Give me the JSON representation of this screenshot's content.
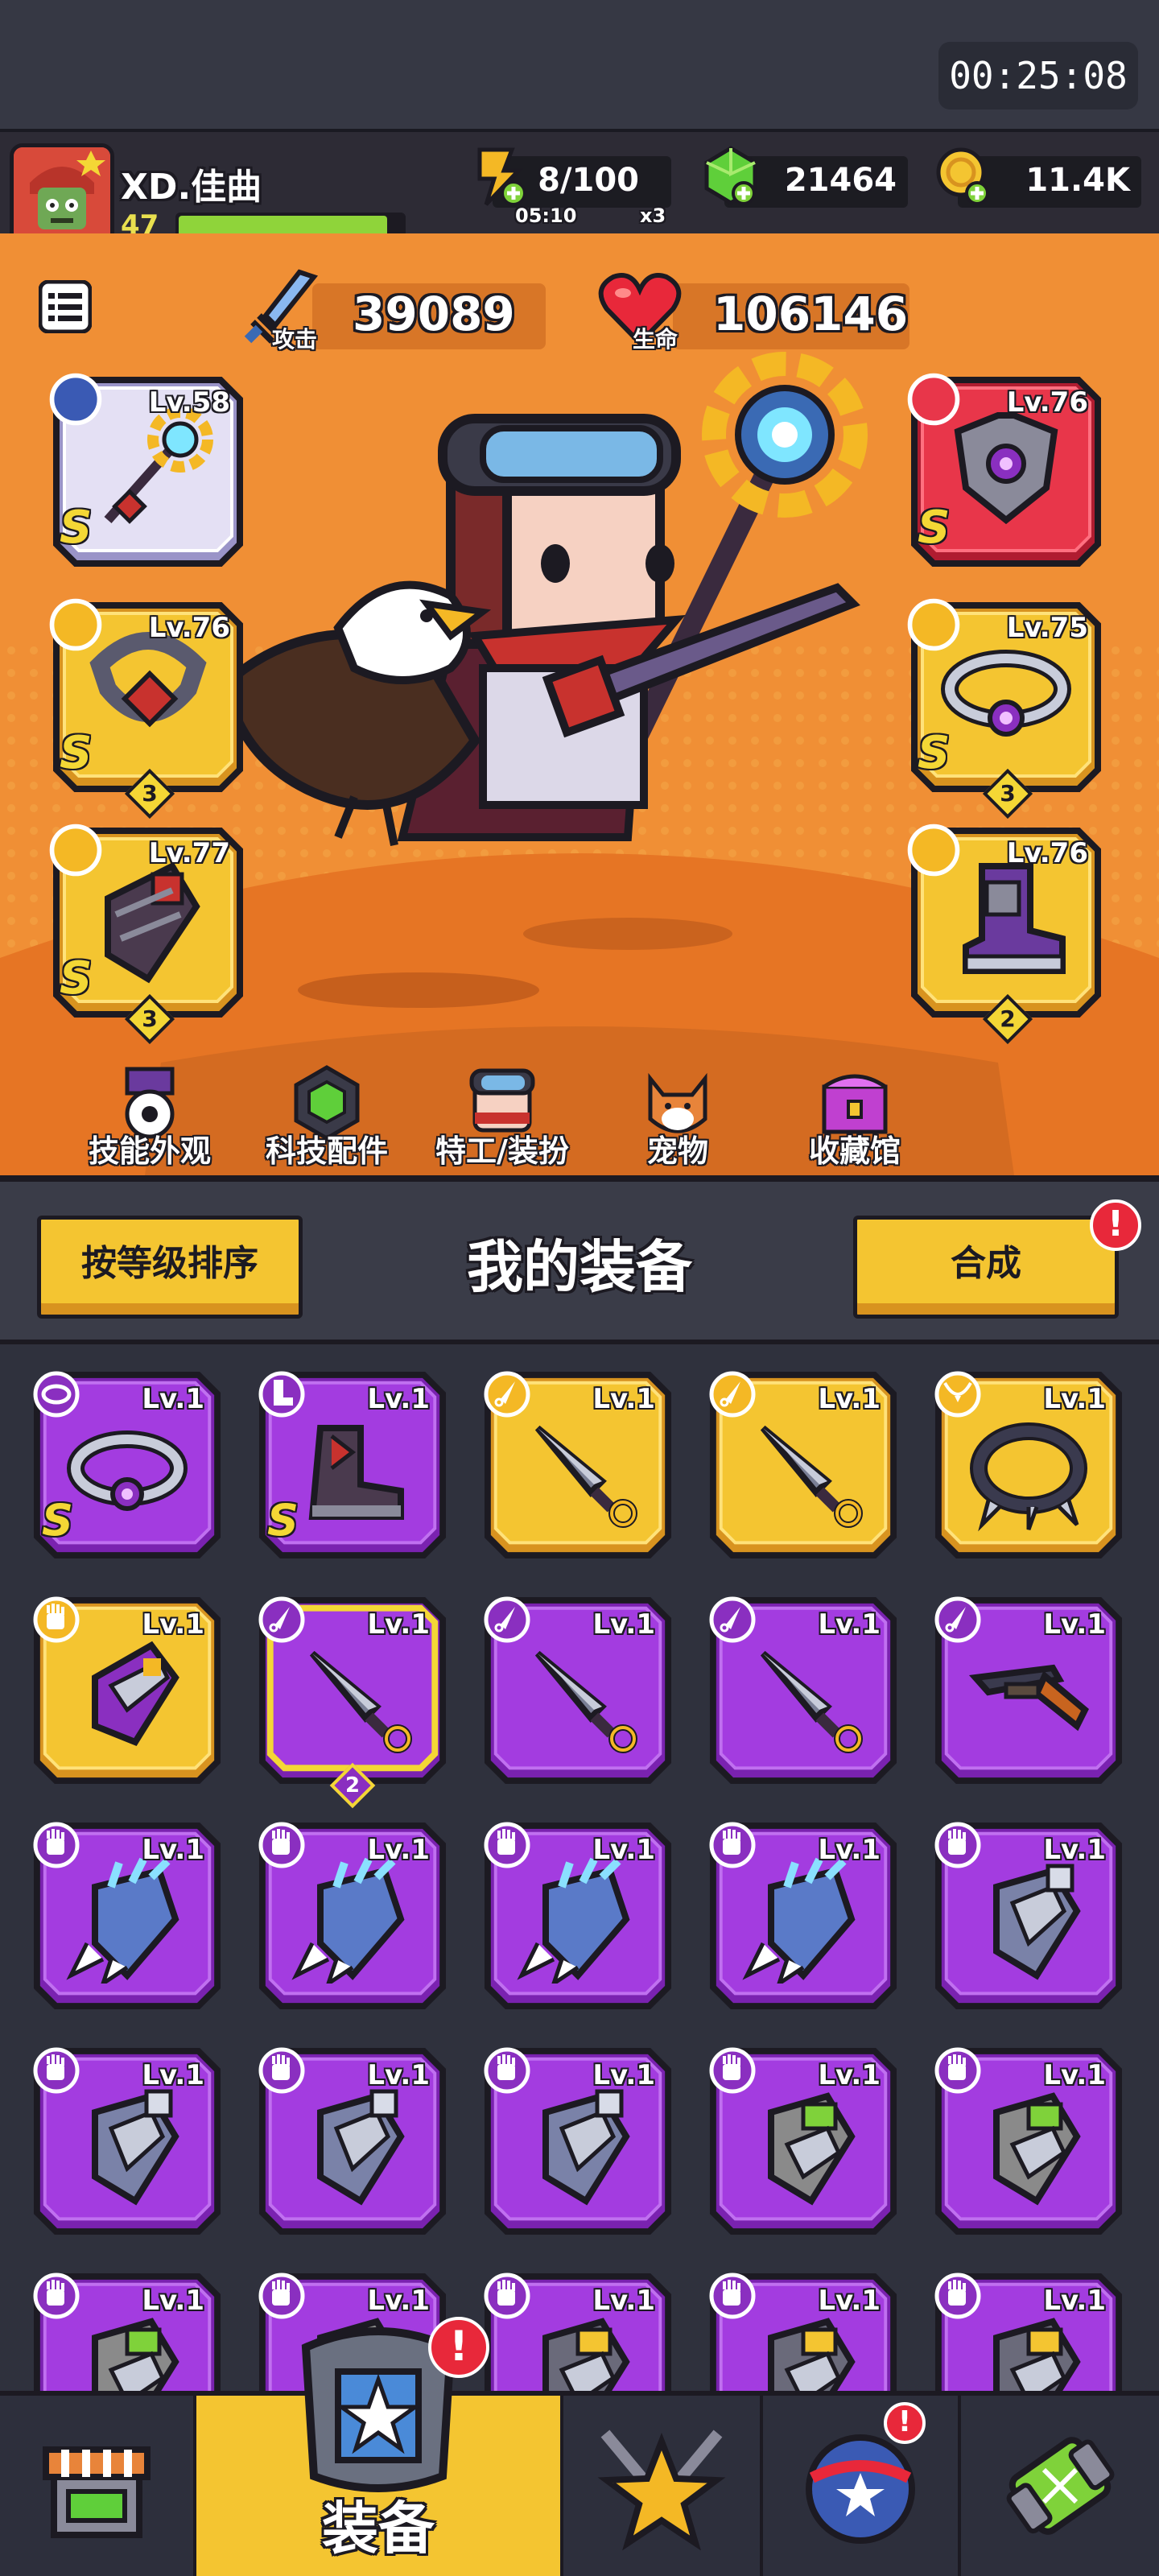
{
  "status_bar": {
    "clock": "00:25:08"
  },
  "player": {
    "name": "XD.佳曲",
    "level": "47",
    "xp_fraction": 0.93
  },
  "resources": {
    "energy": {
      "value": "8/100",
      "timer": "05:10",
      "multiplier": "x3"
    },
    "gems": {
      "value": "21464"
    },
    "coins": {
      "value": "11.4K"
    }
  },
  "stats": {
    "attack": {
      "label": "攻击",
      "value": "39089"
    },
    "health": {
      "label": "生命",
      "value": "106146"
    }
  },
  "equipped": [
    {
      "slot": "weapon",
      "level": "Lv.58",
      "grade": "S",
      "count": "",
      "frame": "silver",
      "icon": "kunai-icon",
      "item": "staff-icon"
    },
    {
      "slot": "necklace",
      "level": "Lv.76",
      "grade": "S",
      "count": "3",
      "frame": "gold",
      "icon": "necklace-icon",
      "item": "chain-necklace-icon"
    },
    {
      "slot": "gloves",
      "level": "Lv.77",
      "grade": "S",
      "count": "3",
      "frame": "gold",
      "icon": "glove-icon",
      "item": "gauntlet-icon"
    },
    {
      "slot": "armor",
      "level": "Lv.76",
      "grade": "S",
      "count": "",
      "frame": "red",
      "icon": "shirt-icon",
      "item": "armor-icon"
    },
    {
      "slot": "belt",
      "level": "Lv.75",
      "grade": "S",
      "count": "3",
      "frame": "gold",
      "icon": "belt-icon",
      "item": "belt-item-icon"
    },
    {
      "slot": "boots",
      "level": "Lv.76",
      "grade": "",
      "count": "2",
      "frame": "gold",
      "icon": "boot-icon",
      "item": "boots-item-icon"
    }
  ],
  "categories": [
    {
      "label": "技能外观",
      "icon": "skill-skin-icon"
    },
    {
      "label": "科技配件",
      "icon": "tech-part-icon"
    },
    {
      "label": "特工/装扮",
      "icon": "agent-icon"
    },
    {
      "label": "宠物",
      "icon": "pet-icon"
    },
    {
      "label": "收藏馆",
      "icon": "collection-icon"
    }
  ],
  "section": {
    "sort_label": "按等级排序",
    "title": "我的装备",
    "merge_label": "合成",
    "merge_alert": "!"
  },
  "inventory": [
    {
      "level": "Lv.1",
      "grade": "S",
      "rarity": "purple",
      "type": "belt-icon",
      "item": "belt"
    },
    {
      "level": "Lv.1",
      "grade": "S",
      "rarity": "purple",
      "type": "boot-icon",
      "item": "boots"
    },
    {
      "level": "Lv.1",
      "grade": "",
      "rarity": "gold",
      "type": "kunai-icon",
      "item": "kunai"
    },
    {
      "level": "Lv.1",
      "grade": "",
      "rarity": "gold",
      "type": "kunai-icon",
      "item": "kunai"
    },
    {
      "level": "Lv.1",
      "grade": "",
      "rarity": "gold",
      "type": "necklace-icon",
      "item": "spiked-collar"
    },
    {
      "level": "Lv.1",
      "grade": "",
      "rarity": "gold",
      "type": "glove-icon",
      "item": "gauntlet"
    },
    {
      "level": "Lv.1",
      "grade": "",
      "rarity": "purple-selected",
      "type": "kunai-icon",
      "item": "kunai",
      "count": "2"
    },
    {
      "level": "Lv.1",
      "grade": "",
      "rarity": "purple",
      "type": "kunai-icon",
      "item": "kunai"
    },
    {
      "level": "Lv.1",
      "grade": "",
      "rarity": "purple",
      "type": "kunai-icon",
      "item": "kunai"
    },
    {
      "level": "Lv.1",
      "grade": "",
      "rarity": "purple",
      "type": "kunai-icon",
      "item": "shotgun"
    },
    {
      "level": "Lv.1",
      "grade": "",
      "rarity": "purple",
      "type": "glove-icon",
      "item": "claw"
    },
    {
      "level": "Lv.1",
      "grade": "",
      "rarity": "purple",
      "type": "glove-icon",
      "item": "claw"
    },
    {
      "level": "Lv.1",
      "grade": "",
      "rarity": "purple",
      "type": "glove-icon",
      "item": "claw"
    },
    {
      "level": "Lv.1",
      "grade": "",
      "rarity": "purple",
      "type": "glove-icon",
      "item": "claw"
    },
    {
      "level": "Lv.1",
      "grade": "",
      "rarity": "purple",
      "type": "glove-icon",
      "item": "steel-glove"
    },
    {
      "level": "Lv.1",
      "grade": "",
      "rarity": "purple",
      "type": "glove-icon",
      "item": "steel-glove"
    },
    {
      "level": "Lv.1",
      "grade": "",
      "rarity": "purple",
      "type": "glove-icon",
      "item": "steel-glove"
    },
    {
      "level": "Lv.1",
      "grade": "",
      "rarity": "purple",
      "type": "glove-icon",
      "item": "steel-glove"
    },
    {
      "level": "Lv.1",
      "grade": "",
      "rarity": "purple",
      "type": "glove-icon",
      "item": "green-glove"
    },
    {
      "level": "Lv.1",
      "grade": "",
      "rarity": "purple",
      "type": "glove-icon",
      "item": "green-glove"
    },
    {
      "level": "Lv.1",
      "grade": "",
      "rarity": "purple",
      "type": "glove-icon",
      "item": "green-glove"
    },
    {
      "level": "Lv.1",
      "grade": "",
      "rarity": "purple",
      "type": "glove-icon",
      "item": "green-glove"
    },
    {
      "level": "Lv.1",
      "grade": "",
      "rarity": "purple",
      "type": "glove-icon",
      "item": "gold-glove"
    },
    {
      "level": "Lv.1",
      "grade": "",
      "rarity": "purple",
      "type": "glove-icon",
      "item": "gold-glove"
    },
    {
      "level": "Lv.1",
      "grade": "",
      "rarity": "purple",
      "type": "glove-icon",
      "item": "gold-glove"
    }
  ],
  "bottom_nav": {
    "shop": {
      "icon": "shop-icon"
    },
    "equip": {
      "label": "装备",
      "icon": "equipment-icon",
      "alert": "!"
    },
    "battle": {
      "icon": "battle-star-icon"
    },
    "orb": {
      "icon": "star-orb-icon",
      "alert": "!"
    },
    "lab": {
      "icon": "dna-capsule-icon"
    }
  },
  "colors": {
    "gold_frame": "#f4c531",
    "purple_frame": "#a33ce0",
    "red_frame": "#e8364a",
    "hero_bg": "#f08f35"
  }
}
